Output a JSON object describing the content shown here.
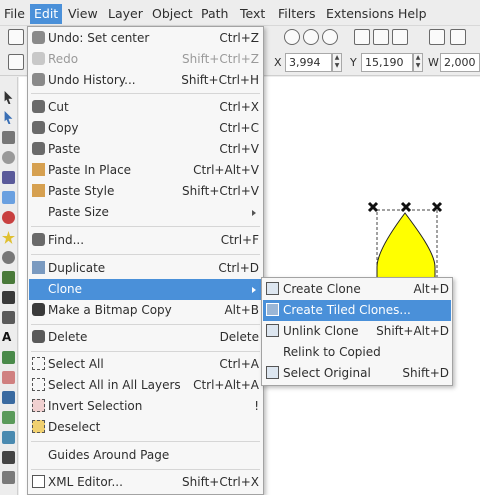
{
  "menubar": {
    "items": [
      {
        "label": "File",
        "active": false
      },
      {
        "label": "Edit",
        "active": true
      },
      {
        "label": "View",
        "active": false
      },
      {
        "label": "Layer",
        "active": false
      },
      {
        "label": "Object",
        "active": false
      },
      {
        "label": "Path",
        "active": false
      },
      {
        "label": "Text",
        "active": false
      },
      {
        "label": "Filters",
        "active": false
      },
      {
        "label": "Extensions",
        "active": false
      },
      {
        "label": "Help",
        "active": false
      }
    ]
  },
  "toolbar": {
    "x_label": "X",
    "x_value": "3,994",
    "y_label": "Y",
    "y_value": "15,190",
    "w_label": "W",
    "w_value": "2,000"
  },
  "edit_menu": {
    "items": [
      {
        "label": "Undo: Set center",
        "accel": "Ctrl+Z",
        "icon": "undo-icon",
        "disabled": false
      },
      {
        "label": "Redo",
        "accel": "Shift+Ctrl+Z",
        "icon": "redo-icon",
        "disabled": true
      },
      {
        "label": "Undo History...",
        "accel": "Shift+Ctrl+H",
        "icon": "history-icon",
        "disabled": false
      },
      {
        "label": "Cut",
        "accel": "Ctrl+X",
        "icon": "cut-icon",
        "disabled": false
      },
      {
        "label": "Copy",
        "accel": "Ctrl+C",
        "icon": "copy-icon",
        "disabled": false
      },
      {
        "label": "Paste",
        "accel": "Ctrl+V",
        "icon": "paste-icon",
        "disabled": false
      },
      {
        "label": "Paste In Place",
        "accel": "Ctrl+Alt+V",
        "icon": "paste-in-place-icon",
        "disabled": false
      },
      {
        "label": "Paste Style",
        "accel": "Shift+Ctrl+V",
        "icon": "paste-style-icon",
        "disabled": false
      },
      {
        "label": "Paste Size",
        "accel": "",
        "icon": "",
        "disabled": false
      },
      {
        "label": "Find...",
        "accel": "Ctrl+F",
        "icon": "find-icon",
        "disabled": false
      },
      {
        "label": "Duplicate",
        "accel": "Ctrl+D",
        "icon": "duplicate-icon",
        "disabled": false
      },
      {
        "label": "Clone",
        "accel": "",
        "icon": "",
        "disabled": false
      },
      {
        "label": "Make a Bitmap Copy",
        "accel": "Alt+B",
        "icon": "bitmap-copy-icon",
        "disabled": false
      },
      {
        "label": "Delete",
        "accel": "Delete",
        "icon": "delete-icon",
        "disabled": false
      },
      {
        "label": "Select All",
        "accel": "Ctrl+A",
        "icon": "select-all-icon",
        "disabled": false
      },
      {
        "label": "Select All in All Layers",
        "accel": "Ctrl+Alt+A",
        "icon": "select-all-layers-icon",
        "disabled": false
      },
      {
        "label": "Invert Selection",
        "accel": "!",
        "icon": "invert-selection-icon",
        "disabled": false
      },
      {
        "label": "Deselect",
        "accel": "",
        "icon": "deselect-icon",
        "disabled": false
      },
      {
        "label": "Guides Around Page",
        "accel": "",
        "icon": "",
        "disabled": false
      },
      {
        "label": "XML Editor...",
        "accel": "Shift+Ctrl+X",
        "icon": "xml-editor-icon",
        "disabled": false
      }
    ]
  },
  "clone_submenu": {
    "items": [
      {
        "label": "Create Clone",
        "accel": "Alt+D",
        "icon": "create-clone-icon"
      },
      {
        "label": "Create Tiled Clones...",
        "accel": "",
        "icon": "tiled-clones-icon"
      },
      {
        "label": "Unlink Clone",
        "accel": "Shift+Alt+D",
        "icon": "unlink-clone-icon"
      },
      {
        "label": "Relink to Copied",
        "accel": "",
        "icon": ""
      },
      {
        "label": "Select Original",
        "accel": "Shift+D",
        "icon": "select-original-icon"
      }
    ]
  },
  "colors": {
    "highlight": "#4a90d9",
    "shape_fill": "#ffff00"
  }
}
